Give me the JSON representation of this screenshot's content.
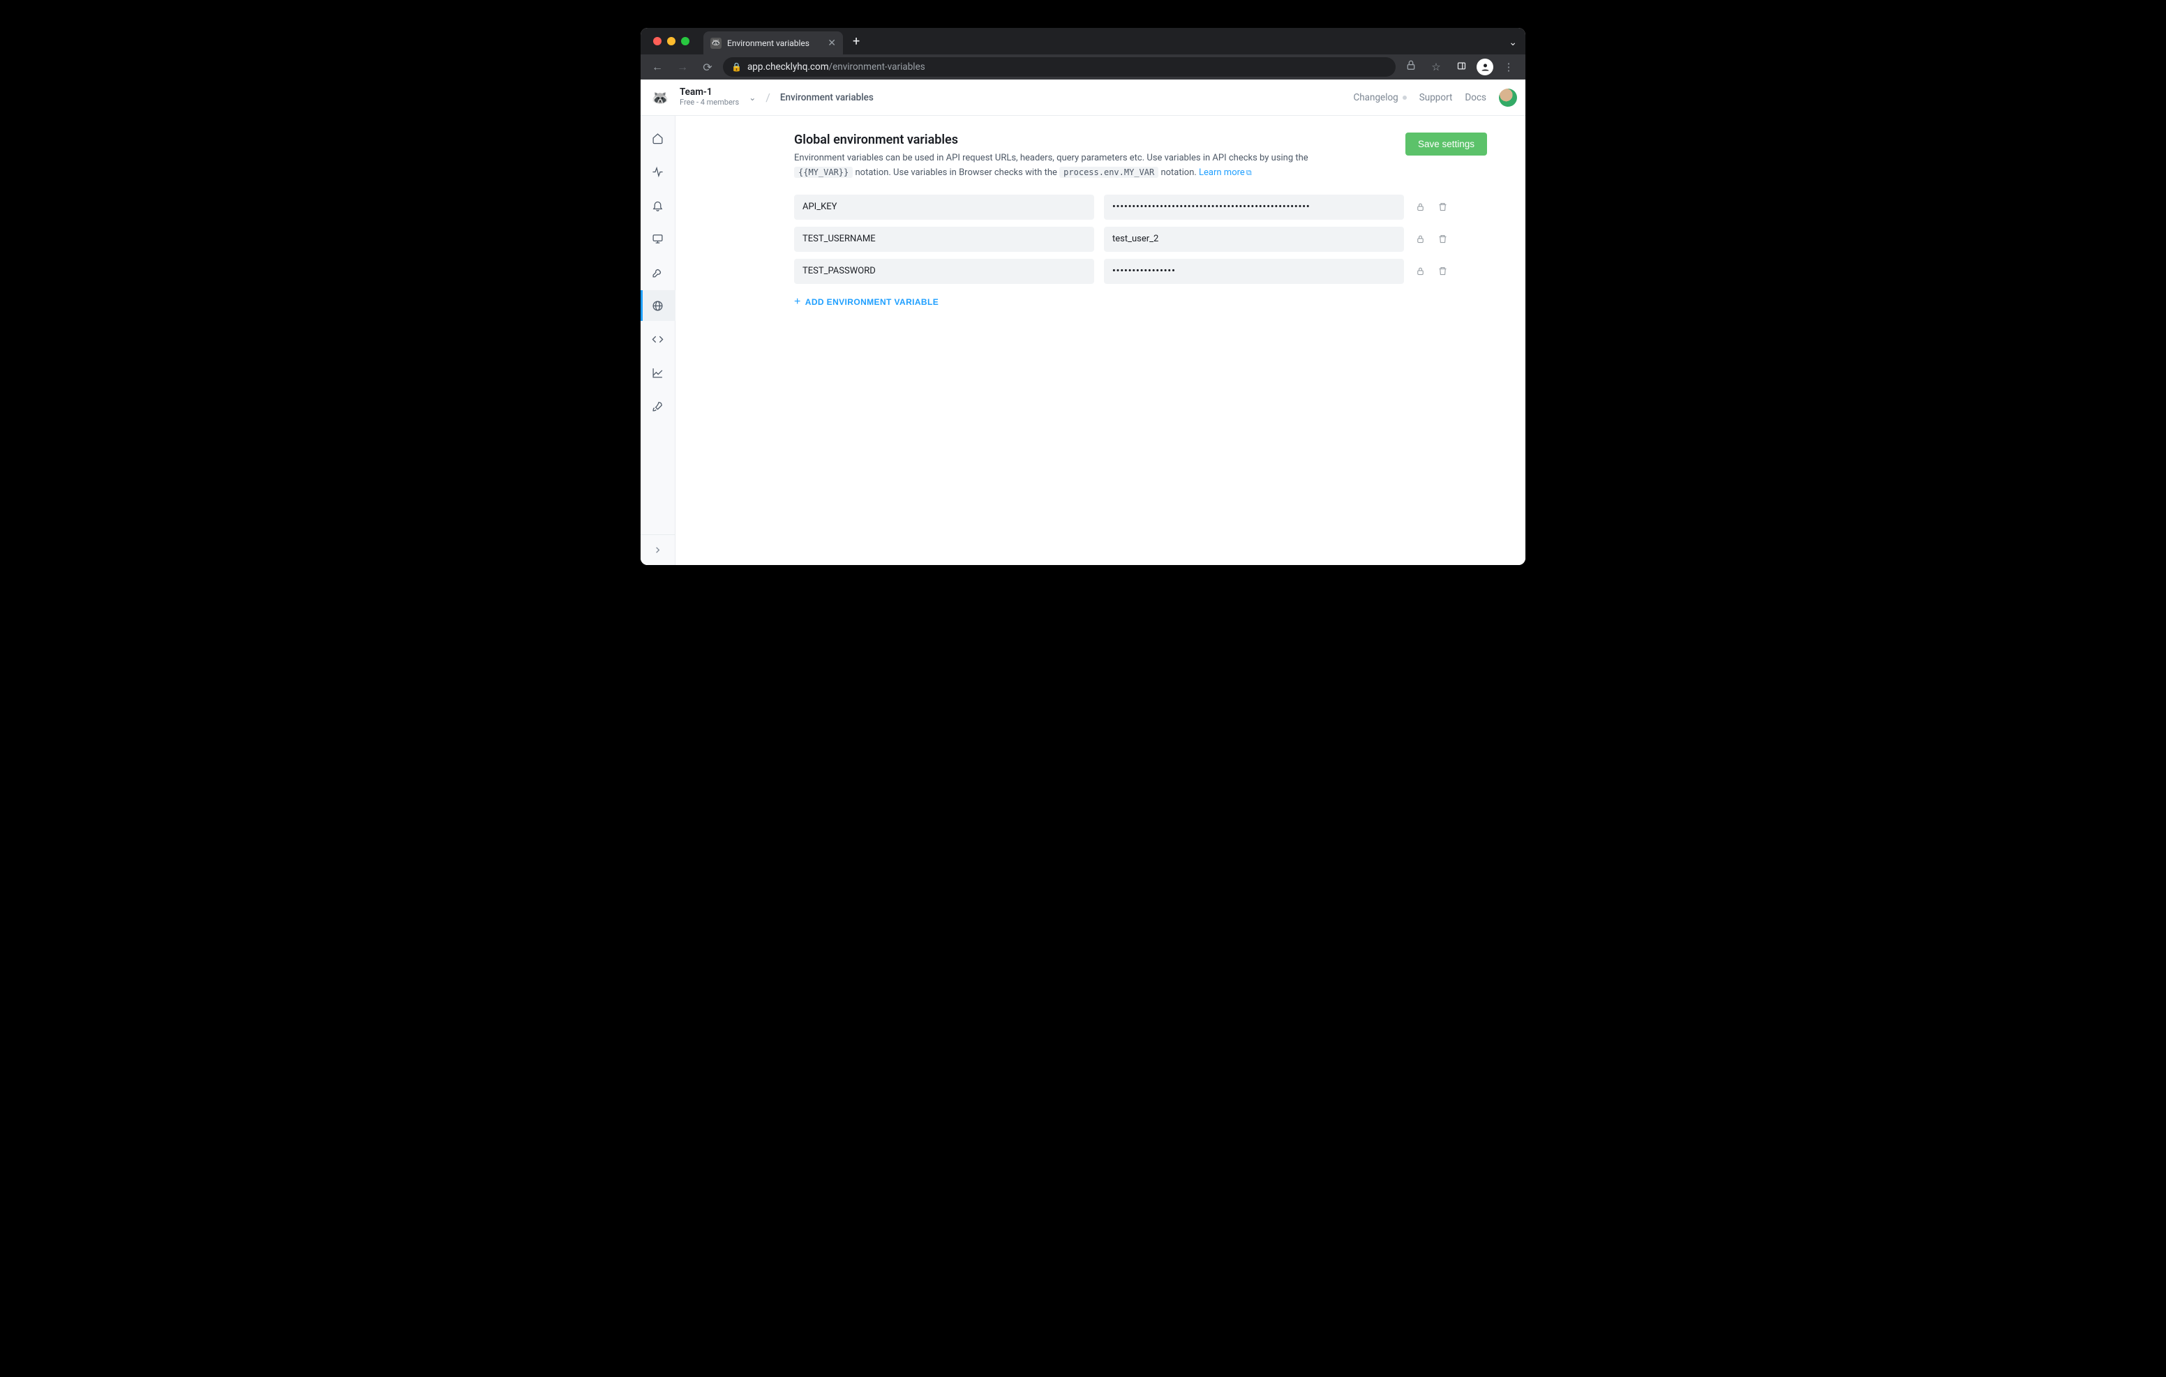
{
  "browser": {
    "tab_title": "Environment variables",
    "url_host": "app.checklyhq.com",
    "url_path": "/environment-variables"
  },
  "header": {
    "team_name": "Team-1",
    "team_sub": "Free - 4 members",
    "breadcrumb_current": "Environment variables",
    "links": {
      "changelog": "Changelog",
      "support": "Support",
      "docs": "Docs"
    }
  },
  "sidebar": {
    "items": [
      {
        "name": "home"
      },
      {
        "name": "activity"
      },
      {
        "name": "alerts"
      },
      {
        "name": "dashboards"
      },
      {
        "name": "maintenance"
      },
      {
        "name": "env-vars",
        "active": true
      },
      {
        "name": "code"
      },
      {
        "name": "reporting"
      },
      {
        "name": "launch"
      }
    ]
  },
  "page": {
    "title": "Global environment variables",
    "desc_pre": "Environment variables can be used in API request URLs, headers, query parameters etc. Use variables in API checks by using the ",
    "code1": "{{MY_VAR}}",
    "desc_mid": " notation. Use variables in Browser checks with the ",
    "code2": "process.env.MY_VAR",
    "desc_post": " notation. ",
    "learn_more": "Learn more",
    "save_button": "Save settings",
    "add_button": "ADD ENVIRONMENT VARIABLE"
  },
  "variables": [
    {
      "key": "API_KEY",
      "value": "••••••••••••••••••••••••••••••••••••••••••••••••••",
      "masked": true
    },
    {
      "key": "TEST_USERNAME",
      "value": "test_user_2",
      "masked": false
    },
    {
      "key": "TEST_PASSWORD",
      "value": "••••••••••••••••",
      "masked": true
    }
  ]
}
